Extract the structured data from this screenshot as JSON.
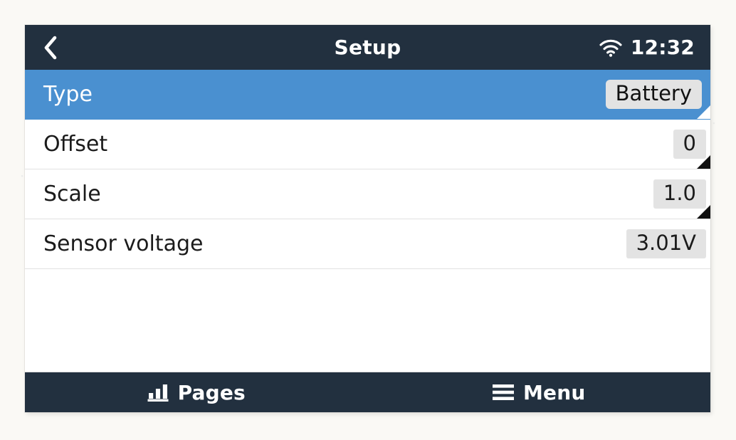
{
  "header": {
    "back_icon": "chevron-left-icon",
    "title": "Setup",
    "wifi_icon": "wifi-icon",
    "time": "12:32"
  },
  "list": {
    "rows": [
      {
        "label": "Type",
        "value": "Battery",
        "selected": true,
        "editable": true
      },
      {
        "label": "Offset",
        "value": "0",
        "selected": false,
        "editable": true
      },
      {
        "label": "Scale",
        "value": "1.0",
        "selected": false,
        "editable": true
      },
      {
        "label": "Sensor voltage",
        "value": "3.01V",
        "selected": false,
        "editable": false
      }
    ]
  },
  "footer": {
    "pages_icon": "bar-chart-icon",
    "pages_label": "Pages",
    "menu_icon": "hamburger-menu-icon",
    "menu_label": "Menu"
  },
  "colors": {
    "header_bg": "#22303f",
    "selected_row": "#4a90d0",
    "row_bg": "#ffffff",
    "value_chip": "#e3e3e3",
    "text": "#1b1b1b",
    "page_bg": "#faf9f5"
  }
}
